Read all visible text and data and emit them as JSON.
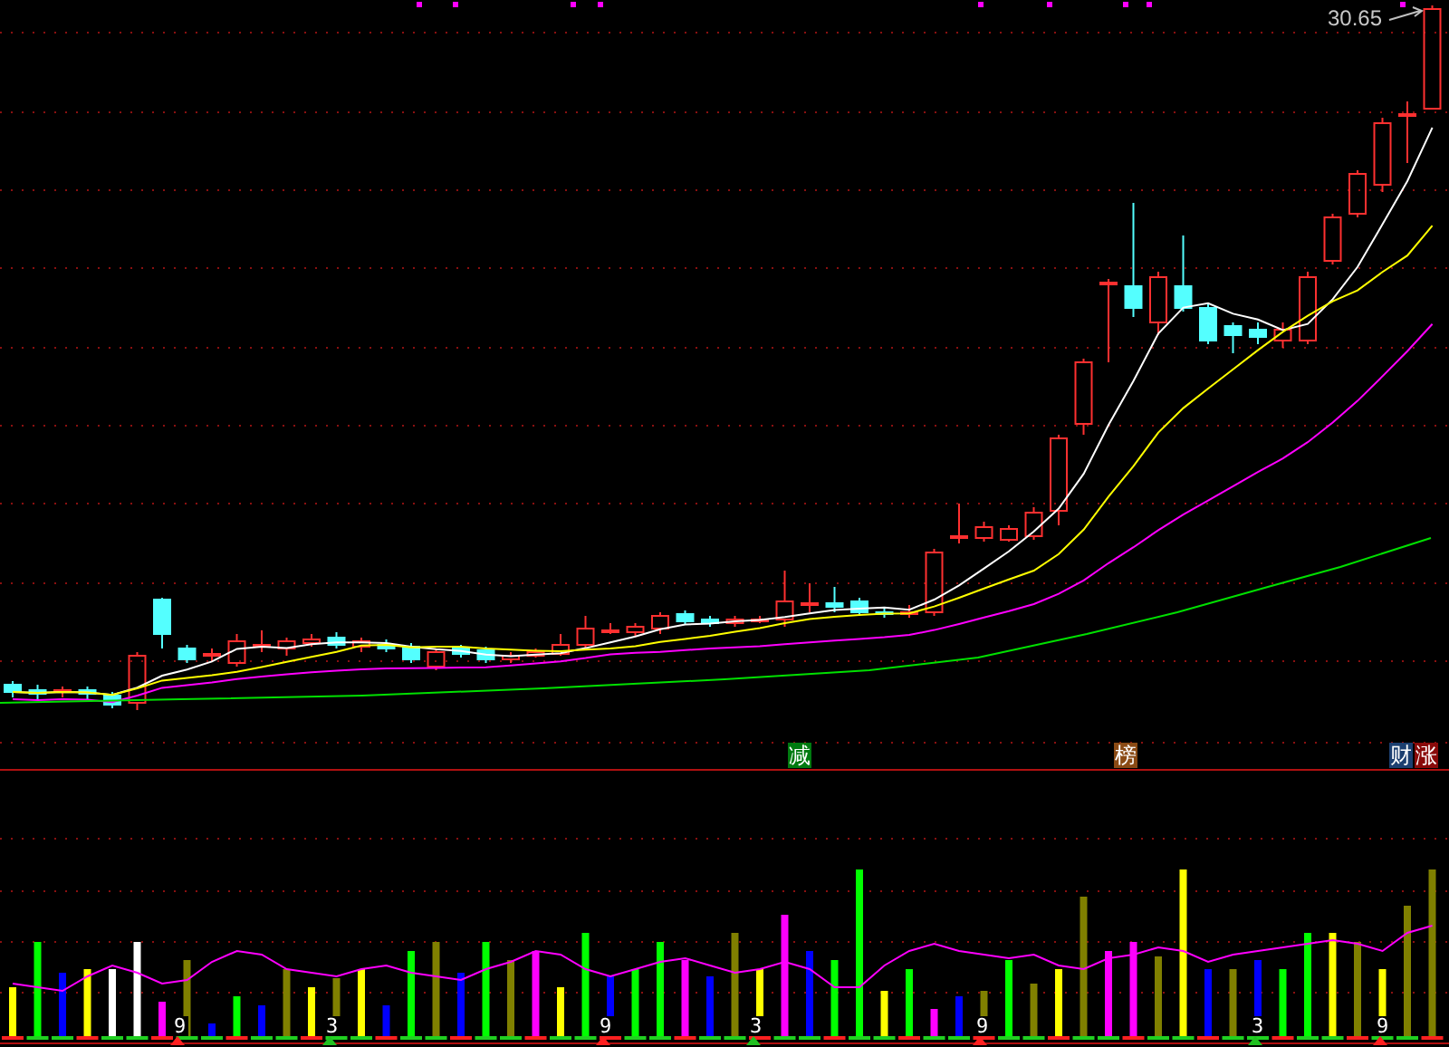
{
  "price_panel": {
    "max_price_label": "30.65",
    "signal_tags": [
      {
        "text": "减",
        "color": "#007a10"
      },
      {
        "text": "榜",
        "color": "#8a4a14"
      },
      {
        "text": "财",
        "color": "#1c3f70"
      },
      {
        "text": "涨",
        "color": "#8a0a0a"
      }
    ]
  },
  "volume_panel": {
    "markers": [
      {
        "text": "9",
        "color": "#ff2020"
      },
      {
        "text": "3",
        "color": "#20c020"
      },
      {
        "text": "9",
        "color": "#ff2020"
      },
      {
        "text": "3",
        "color": "#20c020"
      },
      {
        "text": "9",
        "color": "#ff2020"
      },
      {
        "text": "3",
        "color": "#20c020"
      },
      {
        "text": "9",
        "color": "#ff2020"
      }
    ]
  }
}
